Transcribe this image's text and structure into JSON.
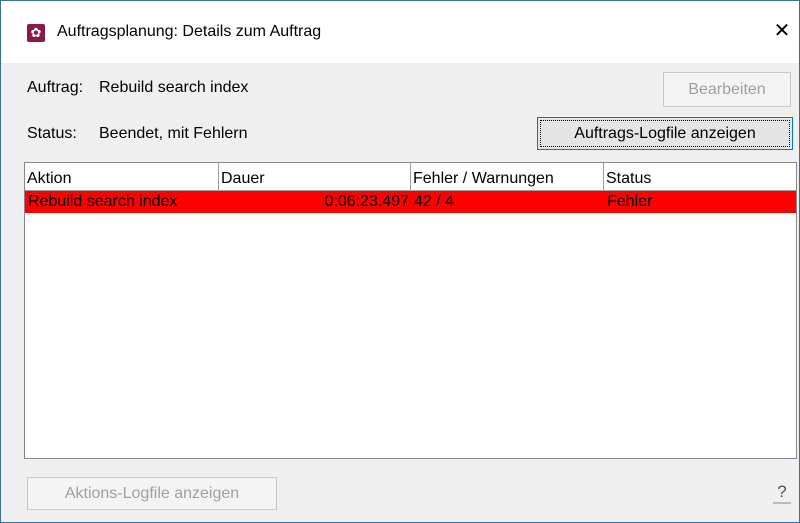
{
  "window": {
    "title": "Auftragsplanung: Details zum Auftrag",
    "app_icon": "gear-icon",
    "close_glyph": "✕"
  },
  "job": {
    "auftrag_label": "Auftrag:",
    "auftrag_value": "Rebuild search index",
    "status_label": "Status:",
    "status_value": "Beendet, mit Fehlern"
  },
  "buttons": {
    "edit": "Bearbeiten",
    "job_logfile": "Auftrags-Logfile anzeigen",
    "action_logfile": "Aktions-Logfile anzeigen"
  },
  "table": {
    "columns": [
      "Aktion",
      "Dauer",
      "Fehler / Warnungen",
      "Status"
    ],
    "rows": [
      {
        "aktion": "Rebuild search index",
        "dauer": "0:06:23.497",
        "fehler_warnungen": "42 / 4",
        "status": "Fehler",
        "row_color": "#ff0000"
      }
    ]
  },
  "help": {
    "glyph": "?",
    "icon": "help-icon"
  }
}
